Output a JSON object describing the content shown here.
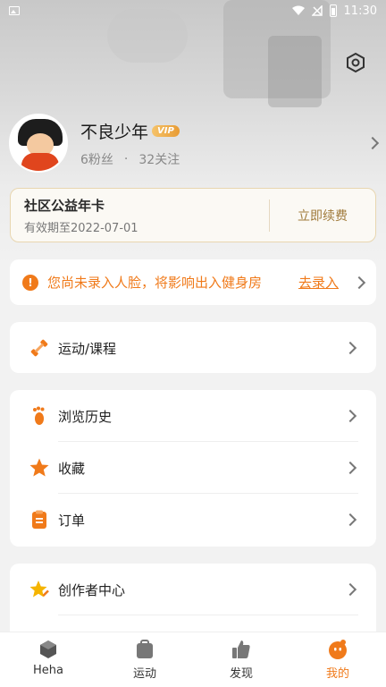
{
  "status_bar": {
    "time": "11:30"
  },
  "profile": {
    "name": "不良少年",
    "vip_badge": "VIP",
    "fans": "6粉丝",
    "separator": "·",
    "following": "32关注"
  },
  "membership": {
    "title": "社区公益年卡",
    "expiry": "有效期至2022-07-01",
    "renew_label": "立即续费"
  },
  "notice": {
    "text": "您尚未录入人脸，将影响出入健身房",
    "action": "去录入"
  },
  "menu": {
    "sport_course": "运动/课程",
    "history": "浏览历史",
    "favorites": "收藏",
    "orders": "订单",
    "creator_center": "创作者中心"
  },
  "tabs": [
    {
      "label": "Heha"
    },
    {
      "label": "运动"
    },
    {
      "label": "发现"
    },
    {
      "label": "我的"
    }
  ],
  "colors": {
    "accent": "#f07a1a",
    "gold": "#a07a3a"
  },
  "icons": {
    "status_left": "image-icon",
    "status_right": [
      "wifi-icon",
      "no-signal-icon",
      "battery-icon"
    ],
    "settings": "hexagon-gear-icon",
    "sport": "dumbbell-icon",
    "history": "footprint-icon",
    "favorites": "star-icon",
    "orders": "clipboard-icon",
    "creator": "star-pencil-icon",
    "tab_icons": [
      "cube-icon",
      "bag-icon",
      "thumbs-up-icon",
      "smiley-icon"
    ]
  }
}
